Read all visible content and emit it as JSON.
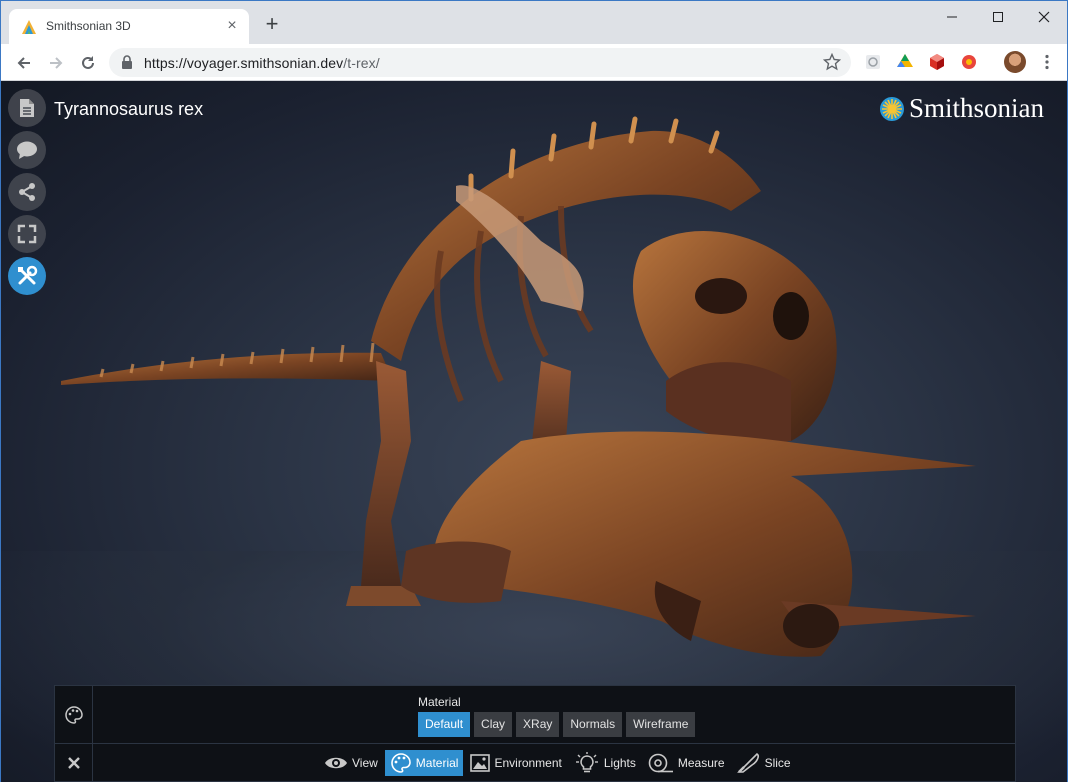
{
  "browser": {
    "tab_title": "Smithsonian 3D",
    "new_tab": "+",
    "url_host": "https://voyager.smithsonian.dev",
    "url_path": "/t-rex/"
  },
  "viewer": {
    "title": "Tyrannosaurus rex",
    "brand": "Smithsonian"
  },
  "sidebar": [
    {
      "name": "document-icon"
    },
    {
      "name": "annotations-icon"
    },
    {
      "name": "share-icon"
    },
    {
      "name": "fullscreen-icon"
    },
    {
      "name": "tools-icon",
      "active": true
    }
  ],
  "material": {
    "label": "Material",
    "options": [
      "Default",
      "Clay",
      "XRay",
      "Normals",
      "Wireframe"
    ],
    "selected": "Default"
  },
  "tools": [
    {
      "label": "View",
      "icon": "eye-icon"
    },
    {
      "label": "Material",
      "icon": "palette-icon",
      "active": true
    },
    {
      "label": "Environment",
      "icon": "image-icon"
    },
    {
      "label": "Lights",
      "icon": "bulb-icon"
    },
    {
      "label": "Measure",
      "icon": "tape-icon"
    },
    {
      "label": "Slice",
      "icon": "knife-icon"
    }
  ],
  "colors": {
    "accent": "#2f8fcf",
    "panel": "#0e1116",
    "background": "#1b2130"
  }
}
